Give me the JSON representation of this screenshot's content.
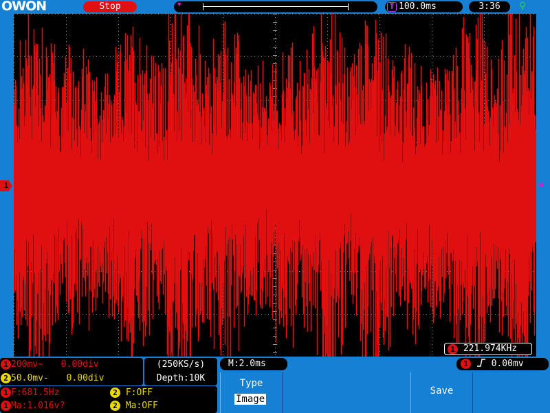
{
  "brand": {
    "logo": "OWON"
  },
  "top_bar": {
    "run_state": "Stop",
    "timebase": "100.0ms",
    "clock": "3:36",
    "icons": {
      "timebase": "T",
      "usb": "usb-icon"
    }
  },
  "screen": {
    "ch1_marker": "1",
    "trigger_marker": "◀",
    "trigger_top_marker": "▼",
    "freq_readout": "221.974KHz",
    "colors": {
      "trace": "#e01010",
      "background": "#000000",
      "grid": "#9a9a9a"
    }
  },
  "channels": {
    "ch1": {
      "badge": "1",
      "scale": "200mv~",
      "offset": "0.00div"
    },
    "ch2": {
      "badge": "2",
      "scale": "50.0mv-",
      "offset": "0.00div"
    }
  },
  "acquisition": {
    "sample_rate": "(250KS/s)",
    "depth": "Depth:10K"
  },
  "measurements": {
    "ch1_freq": "F:681.5Hz",
    "ch2_freq": "F:OFF",
    "ch1_amp": "Ma:1.016v?",
    "ch2_amp": "Ma:OFF"
  },
  "horizontal": {
    "main": "M:2.0ms"
  },
  "trigger": {
    "badge": "1",
    "edge": "ʃ",
    "level": "0.00mv"
  },
  "softkeys": {
    "type": {
      "label": "Type",
      "value": "Image"
    },
    "save": {
      "label": "Save"
    }
  }
}
